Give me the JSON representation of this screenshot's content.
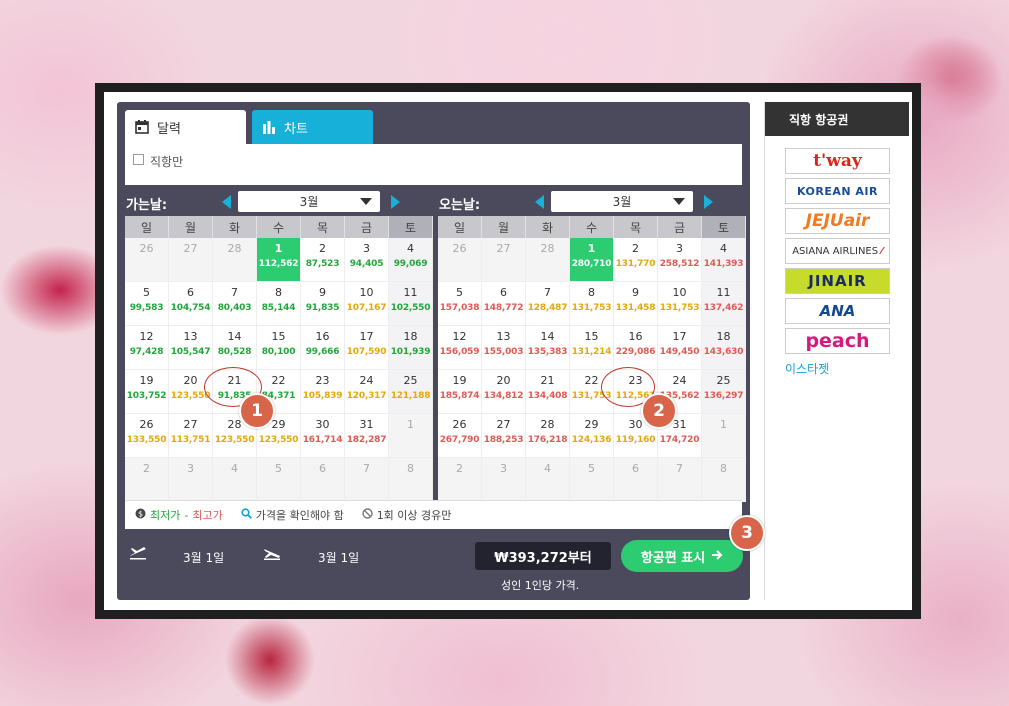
{
  "tabs": {
    "calendar": "달력",
    "chart": "차트"
  },
  "filter": {
    "direct_only": "직항만"
  },
  "depart": {
    "label": "가는날:",
    "month": "3월",
    "dow": [
      "일",
      "월",
      "화",
      "수",
      "목",
      "금",
      "토"
    ],
    "weeks": [
      [
        {
          "d": "26",
          "dim": true
        },
        {
          "d": "27",
          "dim": true
        },
        {
          "d": "28",
          "dim": true
        },
        {
          "d": "1",
          "p": "112,562",
          "c": "w",
          "sel": true
        },
        {
          "d": "2",
          "p": "87,523",
          "c": "g"
        },
        {
          "d": "3",
          "p": "94,405",
          "c": "g"
        },
        {
          "d": "4",
          "p": "99,069",
          "c": "g"
        }
      ],
      [
        {
          "d": "5",
          "p": "99,583",
          "c": "g"
        },
        {
          "d": "6",
          "p": "104,754",
          "c": "g"
        },
        {
          "d": "7",
          "p": "80,403",
          "c": "g"
        },
        {
          "d": "8",
          "p": "85,144",
          "c": "g"
        },
        {
          "d": "9",
          "p": "91,835",
          "c": "g"
        },
        {
          "d": "10",
          "p": "107,167",
          "c": "y"
        },
        {
          "d": "11",
          "p": "102,550",
          "c": "g"
        }
      ],
      [
        {
          "d": "12",
          "p": "97,428",
          "c": "g"
        },
        {
          "d": "13",
          "p": "105,547",
          "c": "g"
        },
        {
          "d": "14",
          "p": "80,528",
          "c": "g"
        },
        {
          "d": "15",
          "p": "80,100",
          "c": "g"
        },
        {
          "d": "16",
          "p": "99,666",
          "c": "g"
        },
        {
          "d": "17",
          "p": "107,590",
          "c": "y"
        },
        {
          "d": "18",
          "p": "101,939",
          "c": "g"
        }
      ],
      [
        {
          "d": "19",
          "p": "103,752",
          "c": "g"
        },
        {
          "d": "20",
          "p": "123,550",
          "c": "y"
        },
        {
          "d": "21",
          "p": "91,835",
          "c": "g"
        },
        {
          "d": "22",
          "p": "84,371",
          "c": "g"
        },
        {
          "d": "23",
          "p": "105,839",
          "c": "y"
        },
        {
          "d": "24",
          "p": "120,317",
          "c": "y"
        },
        {
          "d": "25",
          "p": "121,188",
          "c": "y"
        }
      ],
      [
        {
          "d": "26",
          "p": "133,550",
          "c": "y"
        },
        {
          "d": "27",
          "p": "113,751",
          "c": "y"
        },
        {
          "d": "28",
          "p": "123,550",
          "c": "y"
        },
        {
          "d": "29",
          "p": "123,550",
          "c": "y"
        },
        {
          "d": "30",
          "p": "161,714",
          "c": "r"
        },
        {
          "d": "31",
          "p": "182,287",
          "c": "r"
        },
        {
          "d": "1",
          "dim": true
        }
      ],
      [
        {
          "d": "2",
          "dim": true
        },
        {
          "d": "3",
          "dim": true
        },
        {
          "d": "4",
          "dim": true
        },
        {
          "d": "5",
          "dim": true
        },
        {
          "d": "6",
          "dim": true
        },
        {
          "d": "7",
          "dim": true
        },
        {
          "d": "8",
          "dim": true
        }
      ]
    ]
  },
  "return": {
    "label": "오는날:",
    "month": "3월",
    "dow": [
      "일",
      "월",
      "화",
      "수",
      "목",
      "금",
      "토"
    ],
    "weeks": [
      [
        {
          "d": "26",
          "dim": true
        },
        {
          "d": "27",
          "dim": true
        },
        {
          "d": "28",
          "dim": true
        },
        {
          "d": "1",
          "p": "280,710",
          "c": "w",
          "sel": true
        },
        {
          "d": "2",
          "p": "131,770",
          "c": "y"
        },
        {
          "d": "3",
          "p": "258,512",
          "c": "r"
        },
        {
          "d": "4",
          "p": "141,393",
          "c": "r"
        }
      ],
      [
        {
          "d": "5",
          "p": "157,038",
          "c": "r"
        },
        {
          "d": "6",
          "p": "148,772",
          "c": "r"
        },
        {
          "d": "7",
          "p": "128,487",
          "c": "y"
        },
        {
          "d": "8",
          "p": "131,753",
          "c": "y"
        },
        {
          "d": "9",
          "p": "131,458",
          "c": "y"
        },
        {
          "d": "10",
          "p": "131,753",
          "c": "y"
        },
        {
          "d": "11",
          "p": "137,462",
          "c": "r"
        }
      ],
      [
        {
          "d": "12",
          "p": "156,059",
          "c": "r"
        },
        {
          "d": "13",
          "p": "155,003",
          "c": "r"
        },
        {
          "d": "14",
          "p": "135,383",
          "c": "r"
        },
        {
          "d": "15",
          "p": "131,214",
          "c": "y"
        },
        {
          "d": "16",
          "p": "229,086",
          "c": "r"
        },
        {
          "d": "17",
          "p": "149,450",
          "c": "r"
        },
        {
          "d": "18",
          "p": "143,630",
          "c": "r"
        }
      ],
      [
        {
          "d": "19",
          "p": "185,874",
          "c": "r"
        },
        {
          "d": "20",
          "p": "134,812",
          "c": "r"
        },
        {
          "d": "21",
          "p": "134,408",
          "c": "r"
        },
        {
          "d": "22",
          "p": "131,753",
          "c": "y"
        },
        {
          "d": "23",
          "p": "112,561",
          "c": "y"
        },
        {
          "d": "24",
          "p": "135,562",
          "c": "r"
        },
        {
          "d": "25",
          "p": "136,297",
          "c": "r"
        }
      ],
      [
        {
          "d": "26",
          "p": "267,790",
          "c": "r"
        },
        {
          "d": "27",
          "p": "188,253",
          "c": "r"
        },
        {
          "d": "28",
          "p": "176,218",
          "c": "r"
        },
        {
          "d": "29",
          "p": "124,136",
          "c": "y"
        },
        {
          "d": "30",
          "p": "119,160",
          "c": "y"
        },
        {
          "d": "31",
          "p": "174,720",
          "c": "r"
        },
        {
          "d": "1",
          "dim": true
        }
      ],
      [
        {
          "d": "2",
          "dim": true
        },
        {
          "d": "3",
          "dim": true
        },
        {
          "d": "4",
          "dim": true
        },
        {
          "d": "5",
          "dim": true
        },
        {
          "d": "6",
          "dim": true
        },
        {
          "d": "7",
          "dim": true
        },
        {
          "d": "8",
          "dim": true
        }
      ]
    ]
  },
  "legend": {
    "lowest": "최저가",
    "dash": " - ",
    "highest": "최고가",
    "check_price": "가격을 확인해야 함",
    "stops": "1회 이상 경유만"
  },
  "summary": {
    "depart_date": "3월 1일",
    "return_date": "3월 1일",
    "price": "₩393,272부터",
    "price_note": "성인 1인당 가격.",
    "show_button": "항공편 표시"
  },
  "sidebar": {
    "title": "직항 항공권",
    "airlines": [
      "t'way",
      "KOREAN AIR",
      "JEJUair",
      "ASIANA AIRLINES",
      "JINAIR",
      "ANA",
      "peach"
    ],
    "text_link": "이스타젯"
  },
  "markers": [
    "1",
    "2",
    "3"
  ],
  "colors": {
    "accent_cyan": "#17b0d8",
    "selected_green": "#2ecc71",
    "low_green": "#22a63b",
    "mid_yellow": "#e2a80f",
    "high_red": "#e05a55",
    "marker": "#d8644a"
  }
}
